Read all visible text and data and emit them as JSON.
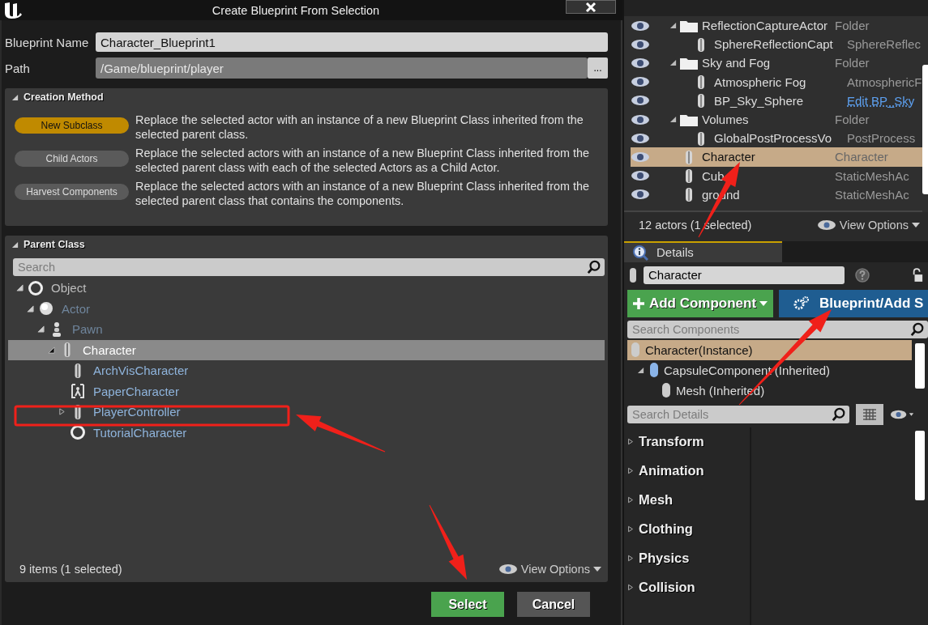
{
  "dialog": {
    "title": "Create Blueprint From Selection",
    "name_field": {
      "label": "Blueprint Name",
      "value": "Character_Blueprint1"
    },
    "path_field": {
      "label": "Path",
      "value": "/Game/blueprint/player",
      "browse": "..."
    },
    "creation_method": {
      "title": "Creation Method",
      "expanded": true,
      "options": [
        {
          "label": "New Subclass",
          "selected": true,
          "description": "Replace the selected actor with an instance of a new Blueprint Class inherited from the selected parent class."
        },
        {
          "label": "Child Actors",
          "selected": false,
          "description": "Replace the selected actors with an instance of a new Blueprint Class inherited from the selected parent class with each of the selected Actors as a Child Actor."
        },
        {
          "label": "Harvest Components",
          "selected": false,
          "description": "Replace the selected actors with an instance of a new Blueprint Class inherited from the selected parent class that contains the components."
        }
      ]
    },
    "parent_class": {
      "title": "Parent Class",
      "expanded": true,
      "search": {
        "placeholder": "Search"
      },
      "tree": [
        {
          "label": "Object",
          "selected": false,
          "expanded": true,
          "children": [
            {
              "label": "Actor",
              "selected": false,
              "expanded": true,
              "children": [
                {
                  "label": "Pawn",
                  "selected": false,
                  "expanded": true,
                  "children": [
                    {
                      "label": "Character",
                      "selected": true,
                      "expanded": true,
                      "children": [
                        {
                          "label": "ArchVisCharacter",
                          "selected": false
                        },
                        {
                          "label": "PaperCharacter",
                          "selected": false
                        },
                        {
                          "label": "PlayerController",
                          "selected": false,
                          "expanded": false
                        },
                        {
                          "label": "TutorialCharacter",
                          "selected": false
                        }
                      ]
                    }
                  ]
                }
              ]
            }
          ]
        }
      ],
      "status": "9 items (1 selected)",
      "view_options": "View Options"
    },
    "buttons": [
      "Select",
      "Cancel"
    ]
  },
  "outliner": {
    "rows": [
      {
        "kind": "folder",
        "label": "ReflectionCaptureActor",
        "type": "Folder",
        "selected": false,
        "expanded": true,
        "children": [
          {
            "kind": "actor",
            "label": "SphereReflectionCapt",
            "type": "SphereReflec",
            "selected": false
          }
        ]
      },
      {
        "kind": "folder",
        "label": "Sky and Fog",
        "type": "Folder",
        "selected": false,
        "expanded": true,
        "children": [
          {
            "kind": "actor",
            "label": "Atmospheric Fog",
            "type": "AtmosphericF",
            "selected": false
          },
          {
            "kind": "actor",
            "label": "BP_Sky_Sphere",
            "type": "Edit BP_Sky",
            "link": true,
            "selected": false
          }
        ]
      },
      {
        "kind": "folder",
        "label": "Volumes",
        "type": "Folder",
        "selected": false,
        "expanded": true,
        "children": [
          {
            "kind": "actor",
            "label": "GlobalPostProcessVo",
            "type": "PostProcess",
            "selected": false
          }
        ]
      },
      {
        "kind": "actor",
        "label": "Character",
        "type": "Character",
        "selected": true
      },
      {
        "kind": "actor",
        "label": "Cub",
        "type": "StaticMeshAc",
        "selected": false
      },
      {
        "kind": "actor",
        "label": "ground",
        "type": "StaticMeshAc",
        "selected": false
      }
    ],
    "status": "12 actors (1 selected)",
    "view_options": "View Options"
  },
  "details": {
    "tab": "Details",
    "name": "Character",
    "add_component": "Add Component",
    "blueprint_button": "Blueprint/Add S",
    "search_components": {
      "placeholder": "Search Components"
    },
    "components": [
      {
        "label": "Character(Instance)",
        "selected": true
      },
      {
        "label": "CapsuleComponent (Inherited)",
        "selected": false,
        "expanded": true,
        "children": [
          {
            "label": "Mesh (Inherited)",
            "selected": false
          }
        ]
      }
    ],
    "search_details": {
      "placeholder": "Search Details"
    },
    "categories": [
      {
        "label": "Transform",
        "expanded": false
      },
      {
        "label": "Animation",
        "expanded": false
      },
      {
        "label": "Mesh",
        "expanded": false
      },
      {
        "label": "Clothing",
        "expanded": false
      },
      {
        "label": "Physics",
        "expanded": false
      },
      {
        "label": "Collision",
        "expanded": false
      }
    ]
  }
}
